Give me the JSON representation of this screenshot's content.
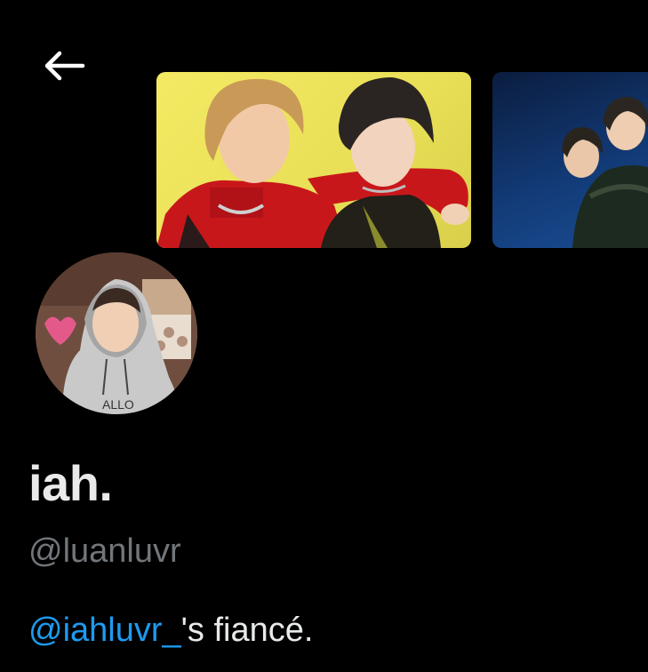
{
  "header": {
    "back_icon": "arrow-left-icon",
    "banners": [
      {
        "name": "header-photo-1",
        "accent": "#f4ea63"
      },
      {
        "name": "header-photo-2",
        "accent": "#123a76"
      }
    ]
  },
  "profile": {
    "display_name": "iah.",
    "handle": "@luanluvr",
    "bio": {
      "mention": "@iahluvr_",
      "text": "'s fiancé."
    }
  },
  "colors": {
    "background": "#000000",
    "text_primary": "#e7e9ea",
    "text_secondary": "#71767b",
    "mention": "#1d9bf0"
  }
}
